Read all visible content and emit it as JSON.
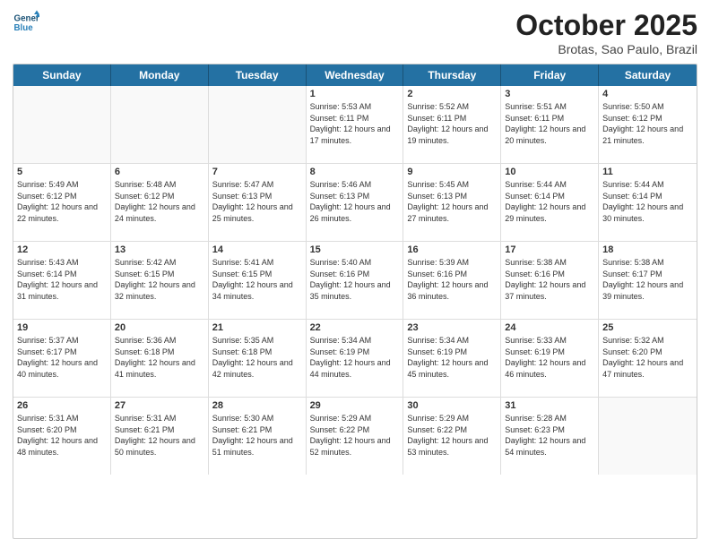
{
  "header": {
    "logo_general": "General",
    "logo_blue": "Blue",
    "title": "October 2025",
    "subtitle": "Brotas, Sao Paulo, Brazil"
  },
  "calendar": {
    "days_of_week": [
      "Sunday",
      "Monday",
      "Tuesday",
      "Wednesday",
      "Thursday",
      "Friday",
      "Saturday"
    ],
    "rows": [
      [
        {
          "day": "",
          "info": ""
        },
        {
          "day": "",
          "info": ""
        },
        {
          "day": "",
          "info": ""
        },
        {
          "day": "1",
          "info": "Sunrise: 5:53 AM\nSunset: 6:11 PM\nDaylight: 12 hours and 17 minutes."
        },
        {
          "day": "2",
          "info": "Sunrise: 5:52 AM\nSunset: 6:11 PM\nDaylight: 12 hours and 19 minutes."
        },
        {
          "day": "3",
          "info": "Sunrise: 5:51 AM\nSunset: 6:11 PM\nDaylight: 12 hours and 20 minutes."
        },
        {
          "day": "4",
          "info": "Sunrise: 5:50 AM\nSunset: 6:12 PM\nDaylight: 12 hours and 21 minutes."
        }
      ],
      [
        {
          "day": "5",
          "info": "Sunrise: 5:49 AM\nSunset: 6:12 PM\nDaylight: 12 hours and 22 minutes."
        },
        {
          "day": "6",
          "info": "Sunrise: 5:48 AM\nSunset: 6:12 PM\nDaylight: 12 hours and 24 minutes."
        },
        {
          "day": "7",
          "info": "Sunrise: 5:47 AM\nSunset: 6:13 PM\nDaylight: 12 hours and 25 minutes."
        },
        {
          "day": "8",
          "info": "Sunrise: 5:46 AM\nSunset: 6:13 PM\nDaylight: 12 hours and 26 minutes."
        },
        {
          "day": "9",
          "info": "Sunrise: 5:45 AM\nSunset: 6:13 PM\nDaylight: 12 hours and 27 minutes."
        },
        {
          "day": "10",
          "info": "Sunrise: 5:44 AM\nSunset: 6:14 PM\nDaylight: 12 hours and 29 minutes."
        },
        {
          "day": "11",
          "info": "Sunrise: 5:44 AM\nSunset: 6:14 PM\nDaylight: 12 hours and 30 minutes."
        }
      ],
      [
        {
          "day": "12",
          "info": "Sunrise: 5:43 AM\nSunset: 6:14 PM\nDaylight: 12 hours and 31 minutes."
        },
        {
          "day": "13",
          "info": "Sunrise: 5:42 AM\nSunset: 6:15 PM\nDaylight: 12 hours and 32 minutes."
        },
        {
          "day": "14",
          "info": "Sunrise: 5:41 AM\nSunset: 6:15 PM\nDaylight: 12 hours and 34 minutes."
        },
        {
          "day": "15",
          "info": "Sunrise: 5:40 AM\nSunset: 6:16 PM\nDaylight: 12 hours and 35 minutes."
        },
        {
          "day": "16",
          "info": "Sunrise: 5:39 AM\nSunset: 6:16 PM\nDaylight: 12 hours and 36 minutes."
        },
        {
          "day": "17",
          "info": "Sunrise: 5:38 AM\nSunset: 6:16 PM\nDaylight: 12 hours and 37 minutes."
        },
        {
          "day": "18",
          "info": "Sunrise: 5:38 AM\nSunset: 6:17 PM\nDaylight: 12 hours and 39 minutes."
        }
      ],
      [
        {
          "day": "19",
          "info": "Sunrise: 5:37 AM\nSunset: 6:17 PM\nDaylight: 12 hours and 40 minutes."
        },
        {
          "day": "20",
          "info": "Sunrise: 5:36 AM\nSunset: 6:18 PM\nDaylight: 12 hours and 41 minutes."
        },
        {
          "day": "21",
          "info": "Sunrise: 5:35 AM\nSunset: 6:18 PM\nDaylight: 12 hours and 42 minutes."
        },
        {
          "day": "22",
          "info": "Sunrise: 5:34 AM\nSunset: 6:19 PM\nDaylight: 12 hours and 44 minutes."
        },
        {
          "day": "23",
          "info": "Sunrise: 5:34 AM\nSunset: 6:19 PM\nDaylight: 12 hours and 45 minutes."
        },
        {
          "day": "24",
          "info": "Sunrise: 5:33 AM\nSunset: 6:19 PM\nDaylight: 12 hours and 46 minutes."
        },
        {
          "day": "25",
          "info": "Sunrise: 5:32 AM\nSunset: 6:20 PM\nDaylight: 12 hours and 47 minutes."
        }
      ],
      [
        {
          "day": "26",
          "info": "Sunrise: 5:31 AM\nSunset: 6:20 PM\nDaylight: 12 hours and 48 minutes."
        },
        {
          "day": "27",
          "info": "Sunrise: 5:31 AM\nSunset: 6:21 PM\nDaylight: 12 hours and 50 minutes."
        },
        {
          "day": "28",
          "info": "Sunrise: 5:30 AM\nSunset: 6:21 PM\nDaylight: 12 hours and 51 minutes."
        },
        {
          "day": "29",
          "info": "Sunrise: 5:29 AM\nSunset: 6:22 PM\nDaylight: 12 hours and 52 minutes."
        },
        {
          "day": "30",
          "info": "Sunrise: 5:29 AM\nSunset: 6:22 PM\nDaylight: 12 hours and 53 minutes."
        },
        {
          "day": "31",
          "info": "Sunrise: 5:28 AM\nSunset: 6:23 PM\nDaylight: 12 hours and 54 minutes."
        },
        {
          "day": "",
          "info": ""
        }
      ]
    ]
  }
}
